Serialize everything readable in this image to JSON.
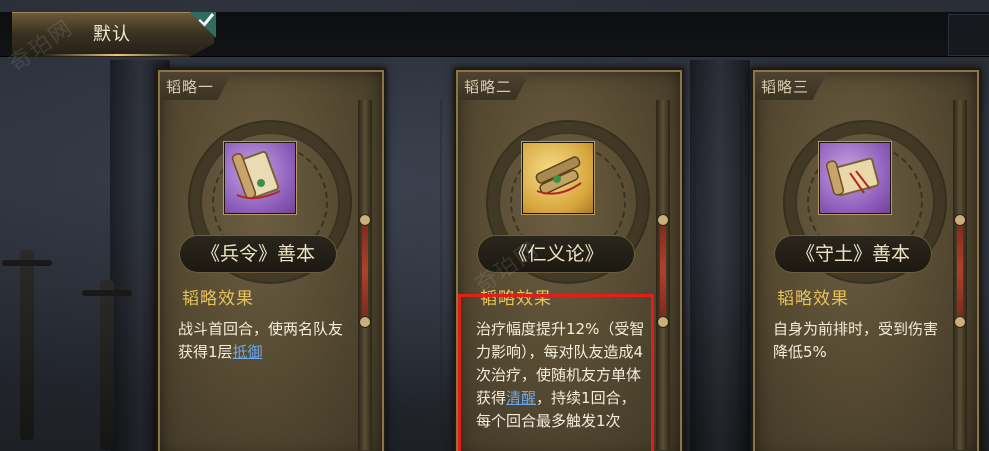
{
  "top_tab": {
    "label": "默认"
  },
  "cards": [
    {
      "title": "韬略一",
      "name": "《兵令》善本",
      "effect_title": "韬略效果",
      "desc_before": "战斗首回合，使两名队友获得1层",
      "desc_link": "抵御",
      "desc_after": "",
      "item_color": "purple"
    },
    {
      "title": "韬略二",
      "name": "《仁义论》",
      "effect_title": "韬略效果",
      "desc_before": "治疗幅度提升12%（受智力影响），每对队友造成4次治疗，使随机友方单体获得",
      "desc_link": "清醒",
      "desc_after": "，持续1回合，每个回合最多触发1次",
      "item_color": "gold"
    },
    {
      "title": "韬略三",
      "name": "《守土》善本",
      "effect_title": "韬略效果",
      "desc_before": "自身为前排时，受到伤害降低5%",
      "desc_link": "",
      "desc_after": "",
      "item_color": "purple"
    }
  ],
  "watermark": "奇珀网",
  "colors": {
    "effect_title": "#e6c25a",
    "link": "#6fa7e6",
    "highlight": "#e21f17"
  }
}
